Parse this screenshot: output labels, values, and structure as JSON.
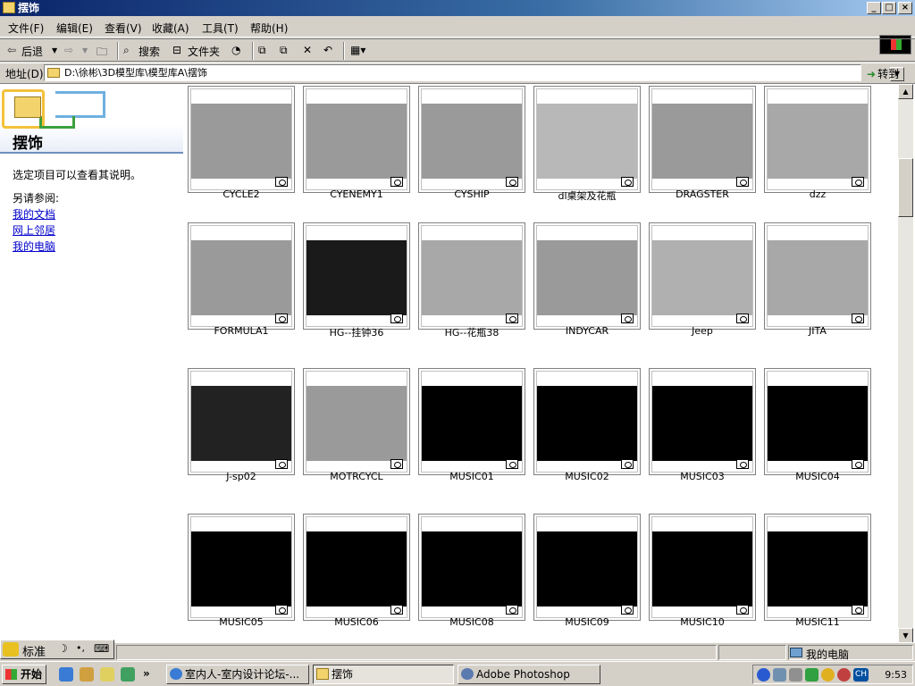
{
  "window": {
    "title": "摆饰",
    "buttons": {
      "minimize": "_",
      "maximize": "□",
      "close": "×"
    }
  },
  "menu": [
    "文件(F)",
    "编辑(E)",
    "查看(V)",
    "收藏(A)",
    "工具(T)",
    "帮助(H)"
  ],
  "toolbar": {
    "back": "后退",
    "search": "搜索",
    "folders": "文件夹"
  },
  "address": {
    "label": "地址(D)",
    "value": "D:\\徐彬\\3D模型库\\模型库A\\摆饰",
    "go": "转到"
  },
  "left_pane": {
    "title": "摆饰",
    "hint": "选定项目可以查看其说明。",
    "see_also": "另请参阅:",
    "links": [
      "我的文档",
      "网上邻居",
      "我的电脑"
    ]
  },
  "files": [
    {
      "name": "CYCLE2",
      "bg": "#9a9a9a"
    },
    {
      "name": "CYENEMY1",
      "bg": "#9a9a9a"
    },
    {
      "name": "CYSHIP",
      "bg": "#9a9a9a"
    },
    {
      "name": "dl桌架及花瓶",
      "bg": "#b8b8b8"
    },
    {
      "name": "DRAGSTER",
      "bg": "#9a9a9a"
    },
    {
      "name": "dzz",
      "bg": "#a8a8a8"
    },
    {
      "name": "FORMULA1",
      "bg": "#9a9a9a"
    },
    {
      "name": "HG--挂钟36",
      "bg": "#1a1a1a"
    },
    {
      "name": "HG--花瓶38",
      "bg": "#a8a8a8"
    },
    {
      "name": "INDYCAR",
      "bg": "#9a9a9a"
    },
    {
      "name": "Jeep",
      "bg": "#b0b0b0"
    },
    {
      "name": "JITA",
      "bg": "#a8a8a8"
    },
    {
      "name": "J-sp02",
      "bg": "#222222"
    },
    {
      "name": "MOTRCYCL",
      "bg": "#9a9a9a"
    },
    {
      "name": "MUSIC01",
      "bg": "#000000"
    },
    {
      "name": "MUSIC02",
      "bg": "#000000"
    },
    {
      "name": "MUSIC03",
      "bg": "#000000"
    },
    {
      "name": "MUSIC04",
      "bg": "#000000"
    },
    {
      "name": "MUSIC05",
      "bg": "#000000"
    },
    {
      "name": "MUSIC06",
      "bg": "#000000"
    },
    {
      "name": "MUSIC08",
      "bg": "#000000"
    },
    {
      "name": "MUSIC09",
      "bg": "#000000"
    },
    {
      "name": "MUSIC10",
      "bg": "#000000"
    },
    {
      "name": "MUSIC11",
      "bg": "#000000"
    }
  ],
  "status": {
    "ime": "标准",
    "location": "我的电脑"
  },
  "taskbar": {
    "start": "开始",
    "tasks": [
      "室内人-室内设计论坛-...",
      "摆饰",
      "Adobe Photoshop"
    ],
    "active_task": 1,
    "tray_lang": "CH",
    "clock": "9:53"
  },
  "colors": {
    "title_start": "#0a246a",
    "title_end": "#a6caf0",
    "link": "#0000cc",
    "face": "#d4d0c8"
  }
}
